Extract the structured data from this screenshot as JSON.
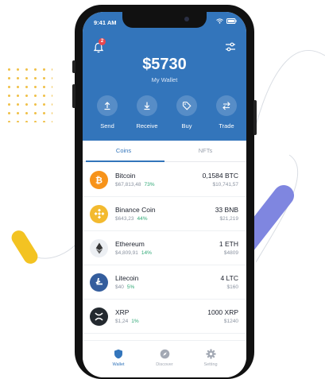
{
  "status": {
    "time": "9:41 AM"
  },
  "header": {
    "notification_count": "2",
    "balance": "$5730",
    "wallet_label": "My Wallet"
  },
  "actions": [
    {
      "label": "Send",
      "icon": "arrow-up-icon"
    },
    {
      "label": "Receive",
      "icon": "arrow-down-icon"
    },
    {
      "label": "Buy",
      "icon": "tag-icon"
    },
    {
      "label": "Trade",
      "icon": "swap-icon"
    }
  ],
  "tabs": [
    {
      "label": "Coins",
      "active": true
    },
    {
      "label": "NFTs",
      "active": false
    }
  ],
  "coins": [
    {
      "name": "Bitcoin",
      "price": "$67,813,48",
      "change": "73%",
      "amount": "0,1584 BTC",
      "value": "$10,741,57",
      "color": "#f7931a",
      "icon": "bitcoin-icon"
    },
    {
      "name": "Binance Coin",
      "price": "$643,23",
      "change": "44%",
      "amount": "33 BNB",
      "value": "$21,219",
      "color": "#f3ba2f",
      "icon": "binance-icon"
    },
    {
      "name": "Ethereum",
      "price": "$4,809,91",
      "change": "14%",
      "amount": "1 ETH",
      "value": "$4809",
      "color": "#eceff3",
      "icon": "ethereum-icon"
    },
    {
      "name": "Litecoin",
      "price": "$40",
      "change": "5%",
      "amount": "4 LTC",
      "value": "$160",
      "color": "#345d9d",
      "icon": "litecoin-icon"
    },
    {
      "name": "XRP",
      "price": "$1,24",
      "change": "1%",
      "amount": "1000 XRP",
      "value": "$1240",
      "color": "#23292f",
      "icon": "xrp-icon"
    }
  ],
  "nav": [
    {
      "label": "Wallet",
      "active": true,
      "icon": "shield-icon"
    },
    {
      "label": "Discover",
      "active": false,
      "icon": "compass-icon"
    },
    {
      "label": "Setting",
      "active": false,
      "icon": "gear-icon"
    }
  ],
  "colors": {
    "primary": "#3375bb",
    "positive": "#2fa876"
  }
}
